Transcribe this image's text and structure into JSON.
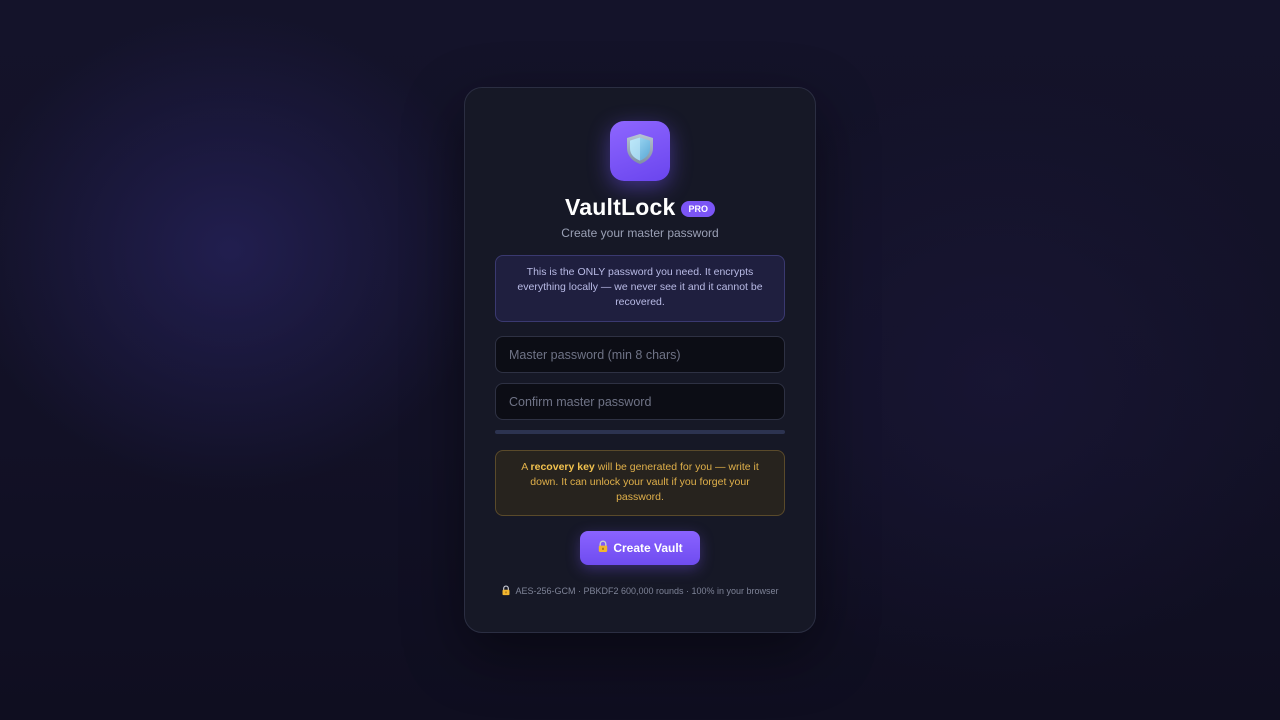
{
  "app": {
    "name": "VaultLock",
    "badge": "PRO",
    "subtitle": "Create your master password",
    "icon": "shield-icon"
  },
  "info": {
    "text": "This is the ONLY password you need. It encrypts everything locally — we never see it and it cannot be recovered."
  },
  "form": {
    "password": {
      "placeholder": "Master password (min 8 chars)",
      "value": ""
    },
    "confirm": {
      "placeholder": "Confirm master password",
      "value": ""
    },
    "strength": 0
  },
  "recovery": {
    "prefix": "A ",
    "highlight": "recovery key",
    "suffix": " will be generated for you — write it down. It can unlock your vault if you forget your password."
  },
  "actions": {
    "create_label": "Create Vault",
    "create_icon": "lock-icon"
  },
  "footer": {
    "text": "AES-256-GCM · PBKDF2 600,000 rounds · 100% in your browser",
    "icon": "lock-icon"
  },
  "colors": {
    "accent": "#7b55f5",
    "warning": "#e0b04a",
    "card": "#161826",
    "background": "#13122a"
  }
}
